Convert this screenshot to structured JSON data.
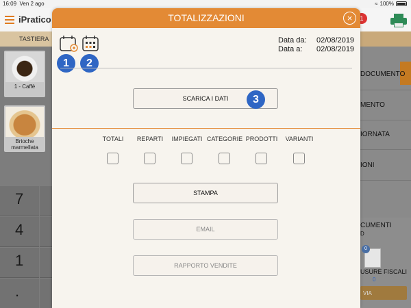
{
  "status_bar": {
    "time": "16:09",
    "date": "Ven 2 ago",
    "battery": "100%"
  },
  "app": {
    "logo": "iPratico",
    "badge_count": "1",
    "tab_label": "TASTIERA",
    "products": [
      {
        "label": "1 - Caffè"
      },
      {
        "label": "Brioche marmellata"
      }
    ],
    "keypad": [
      "7",
      "4",
      "1",
      "."
    ],
    "right_panel": {
      "items": [
        "DOCUMENTO",
        "MENTO",
        "IORNATA",
        "IONI"
      ],
      "docs_title": "CUMENTI",
      "docs_sub": "D",
      "doc_badge": "0",
      "closures_label": "USURE FISCALI",
      "closures_count": "0",
      "send_label": "VIA"
    }
  },
  "modal": {
    "title": "TOTALIZZAZIONI",
    "date_from_label": "Data da:",
    "date_from_value": "02/08/2019",
    "date_to_label": "Data a:",
    "date_to_value": "02/08/2019",
    "markers": [
      "1",
      "2",
      "3"
    ],
    "download_label": "SCARICA I DATI",
    "categories": [
      "TOTALI",
      "REPARTI",
      "IMPIEGATI",
      "CATEGORIE",
      "PRODOTTI",
      "VARIANTI"
    ],
    "print_label": "STAMPA",
    "email_label": "EMAIL",
    "sales_report_label": "RAPPORTO VENDITE"
  },
  "colors": {
    "accent": "#e38a35",
    "marker": "#2f66c4",
    "printer": "#2e8b57"
  },
  "icons": [
    "calendar-settings-icon",
    "calendar-grid-icon",
    "close-icon",
    "hamburger-icon",
    "printer-icon"
  ]
}
